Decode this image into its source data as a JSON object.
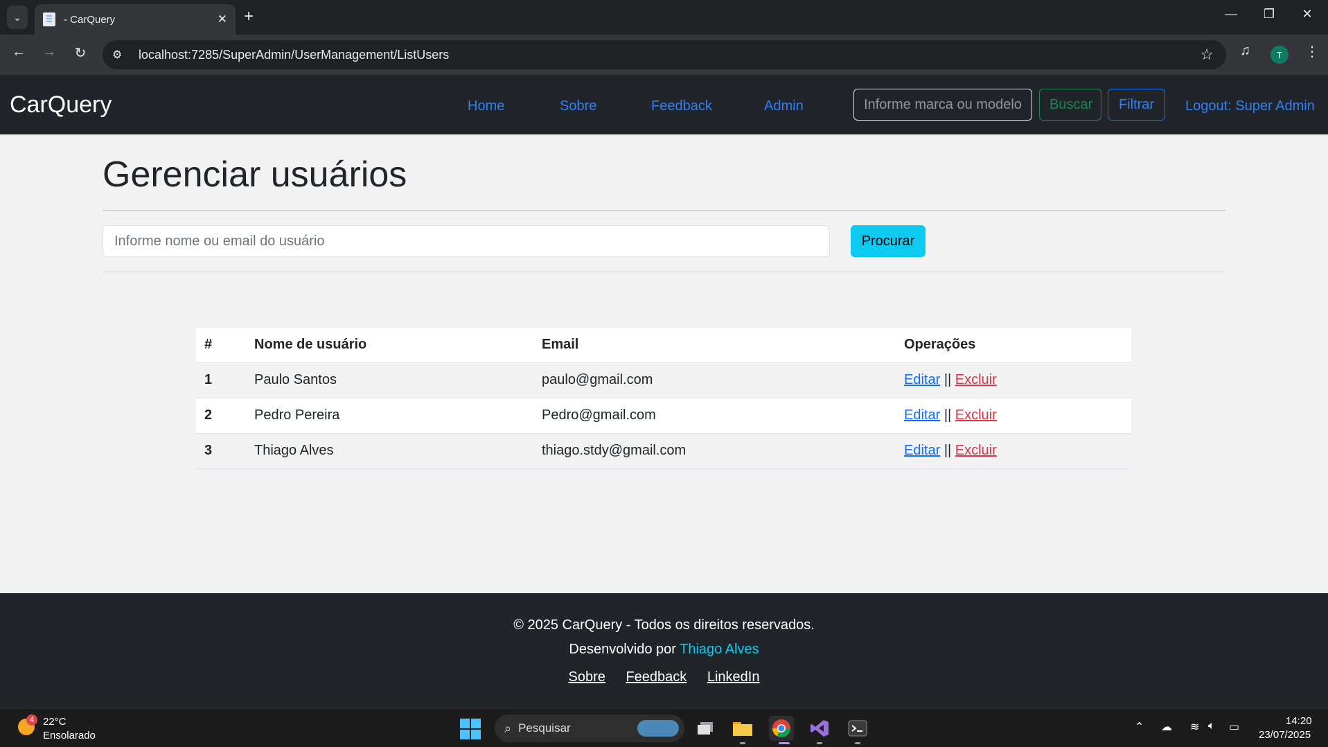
{
  "browser": {
    "tab_title": "- CarQuery",
    "tab_close": "✕",
    "new_tab": "+",
    "url": "localhost:7285/SuperAdmin/UserManagement/ListUsers",
    "profile_initial": "T",
    "window_controls": {
      "minimize": "—",
      "restore": "❐",
      "close": "✕"
    }
  },
  "site": {
    "brand": "CarQuery",
    "nav": {
      "home": "Home",
      "sobre": "Sobre",
      "feedback": "Feedback",
      "admin": "Admin",
      "search_placeholder": "Informe marca ou modelo",
      "buscar": "Buscar",
      "filtrar": "Filtrar",
      "logout": "Logout: Super Admin"
    }
  },
  "main": {
    "title": "Gerenciar usuários",
    "search_placeholder": "Informe nome ou email do usuário",
    "search_button": "Procurar",
    "table": {
      "headers": [
        "#",
        "Nome de usuário",
        "Email",
        "Operações"
      ],
      "rows": [
        {
          "idx": "1",
          "name": "Paulo Santos",
          "email": "paulo@gmail.com"
        },
        {
          "idx": "2",
          "name": "Pedro Pereira",
          "email": "Pedro@gmail.com"
        },
        {
          "idx": "3",
          "name": "Thiago Alves",
          "email": "thiago.stdy@gmail.com"
        }
      ],
      "edit_label": "Editar",
      "separator": "||",
      "delete_label": "Excluir"
    }
  },
  "footer": {
    "copyright": "© 2025 CarQuery - Todos os direitos reservados.",
    "developed_by": "Desenvolvido por",
    "developer": "Thiago Alves",
    "links": [
      "Sobre",
      "Feedback",
      "LinkedIn"
    ]
  },
  "taskbar": {
    "weather_badge": "4",
    "temperature": "22°C",
    "weather": "Ensolarado",
    "search_label": "Pesquisar",
    "time": "14:20",
    "date": "23/07/2025"
  },
  "colors": {
    "navbar_bg": "#212529",
    "link_blue": "#2f80f7",
    "success_green": "#198754",
    "info_cyan": "#0dcaf0",
    "danger_red": "#dc3545"
  }
}
